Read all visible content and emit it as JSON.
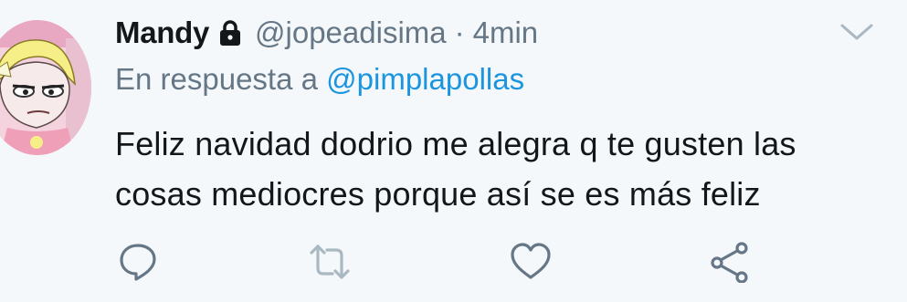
{
  "tweet": {
    "author_name": "Mandy",
    "handle": "@jopeadisima",
    "separator": "·",
    "time": "4min",
    "reply_prefix": "En respuesta a",
    "reply_mention": "@pimplapollas",
    "text_lines": [
      "Feliz navidad dodrio me alegra q te gusten las",
      "cosas mediocres porque así se es más feliz"
    ]
  },
  "icons": {
    "lock": "lock-icon",
    "menu": "chevron-down-icon",
    "reply": "reply-icon",
    "retweet": "retweet-icon",
    "like": "heart-icon",
    "share": "share-icon"
  },
  "colors": {
    "background": "#f5f8fa",
    "text": "#14171a",
    "secondary": "#657786",
    "link": "#1b95e0",
    "icon": "#657786",
    "retweet_disabled": "#aab8c2"
  }
}
